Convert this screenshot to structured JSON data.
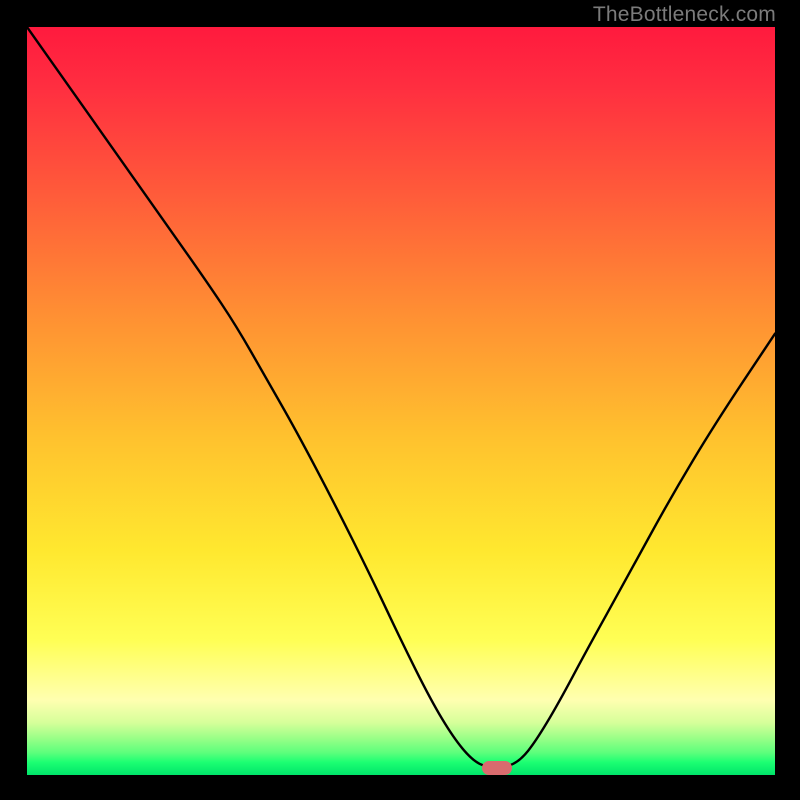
{
  "watermark": "TheBottleneck.com",
  "chart_data": {
    "type": "line",
    "title": "",
    "xlabel": "",
    "ylabel": "",
    "xlim": [
      0,
      100
    ],
    "ylim": [
      0,
      100
    ],
    "grid": false,
    "legend": false,
    "background": "red-yellow-green vertical gradient",
    "marker": {
      "x": 62.8,
      "y": 1.0,
      "color": "#d96b6e",
      "shape": "pill"
    },
    "series": [
      {
        "name": "bottleneck-curve",
        "color": "#000000",
        "x": [
          0.0,
          6.0,
          12.0,
          18.0,
          24.0,
          28.0,
          32.0,
          36.0,
          41.0,
          46.0,
          50.0,
          54.0,
          57.0,
          59.5,
          61.5,
          64.0,
          66.0,
          68.0,
          71.0,
          75.0,
          80.0,
          86.0,
          92.0,
          100.0
        ],
        "values": [
          100.0,
          91.5,
          83.0,
          74.5,
          66.0,
          60.0,
          53.0,
          46.0,
          36.5,
          26.5,
          18.0,
          10.0,
          5.0,
          2.0,
          1.0,
          1.0,
          2.0,
          4.5,
          9.5,
          17.0,
          26.0,
          37.0,
          47.0,
          59.0
        ]
      }
    ]
  }
}
